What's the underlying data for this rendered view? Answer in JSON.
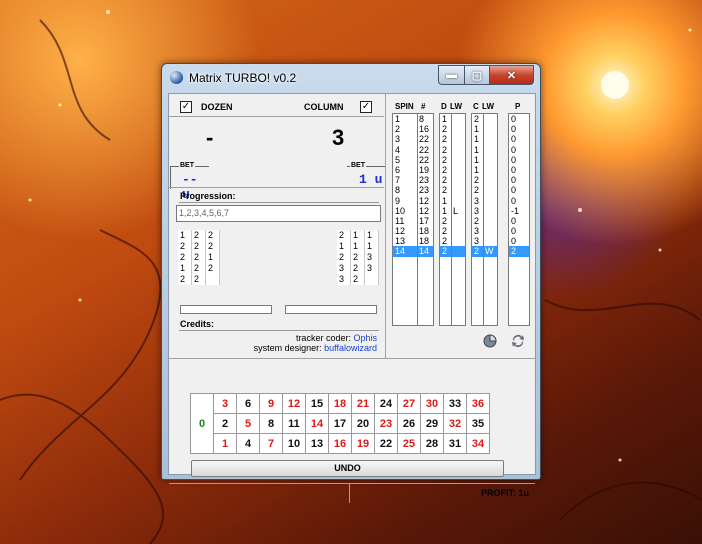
{
  "window": {
    "title": "Matrix TURBO! v0.2",
    "minimize": "▬",
    "maximize": "▢",
    "close": "✕"
  },
  "dozen": {
    "label": "DOZEN",
    "checked": true,
    "value": "-",
    "bet_label": "BET",
    "bet_value": "-- u"
  },
  "column": {
    "label": "COLUMN",
    "checked": true,
    "value": "3",
    "bet_label": "BET",
    "bet_value": "1 u"
  },
  "progression": {
    "label": "Progression:",
    "value": "1,2,3,4,5,6,7"
  },
  "left_grid": [
    [
      "1",
      "2",
      "2"
    ],
    [
      "2",
      "2",
      "2"
    ],
    [
      "2",
      "2",
      "1"
    ],
    [
      "1",
      "2",
      "2"
    ],
    [
      "2",
      "2",
      ""
    ]
  ],
  "right_grid": [
    [
      "2",
      "1",
      "1"
    ],
    [
      "1",
      "1",
      "1"
    ],
    [
      "2",
      "2",
      "3"
    ],
    [
      "3",
      "2",
      "3"
    ],
    [
      "3",
      "2",
      ""
    ]
  ],
  "credits": {
    "label": "Credits:",
    "tracker_label": "tracker coder:",
    "tracker_name": "Ophis",
    "designer_label": "system designer:",
    "designer_name": "buffalowizard"
  },
  "columns_header": {
    "spin": "SPIN",
    "num": "#",
    "d": "D",
    "dlw": "LW",
    "c": "C",
    "clw": "LW",
    "p": "P"
  },
  "spins": [
    "1",
    "2",
    "3",
    "4",
    "5",
    "6",
    "7",
    "8",
    "9",
    "10",
    "11",
    "12",
    "13",
    "14"
  ],
  "numbers": [
    "8",
    "16",
    "22",
    "22",
    "22",
    "19",
    "23",
    "23",
    "12",
    "12",
    "17",
    "18",
    "18",
    "14"
  ],
  "d_vals": [
    "1",
    "2",
    "2",
    "2",
    "2",
    "2",
    "2",
    "2",
    "1",
    "1",
    "2",
    "2",
    "2",
    "2"
  ],
  "d_lw": [
    "",
    "",
    "",
    "",
    "",
    "",
    "",
    "",
    "",
    "L",
    "",
    "",
    "",
    ""
  ],
  "c_vals": [
    "2",
    "1",
    "1",
    "1",
    "1",
    "1",
    "2",
    "2",
    "3",
    "3",
    "2",
    "3",
    "3",
    "2"
  ],
  "c_lw": [
    "",
    "",
    "",
    "",
    "",
    "",
    "",
    "",
    "",
    "",
    "",
    "",
    "",
    "W"
  ],
  "p_vals": [
    "0",
    "0",
    "0",
    "0",
    "0",
    "0",
    "0",
    "0",
    "0",
    "-1",
    "0",
    "0",
    "0",
    "2"
  ],
  "selected_row": 13,
  "board": {
    "zero": "0",
    "rows": [
      [
        {
          "n": "3",
          "c": "red"
        },
        {
          "n": "6",
          "c": "black"
        },
        {
          "n": "9",
          "c": "red"
        },
        {
          "n": "12",
          "c": "red"
        },
        {
          "n": "15",
          "c": "black"
        },
        {
          "n": "18",
          "c": "red"
        },
        {
          "n": "21",
          "c": "red"
        },
        {
          "n": "24",
          "c": "black"
        },
        {
          "n": "27",
          "c": "red"
        },
        {
          "n": "30",
          "c": "red"
        },
        {
          "n": "33",
          "c": "black"
        },
        {
          "n": "36",
          "c": "red"
        }
      ],
      [
        {
          "n": "2",
          "c": "black"
        },
        {
          "n": "5",
          "c": "red"
        },
        {
          "n": "8",
          "c": "black"
        },
        {
          "n": "11",
          "c": "black"
        },
        {
          "n": "14",
          "c": "red"
        },
        {
          "n": "17",
          "c": "black"
        },
        {
          "n": "20",
          "c": "black"
        },
        {
          "n": "23",
          "c": "red"
        },
        {
          "n": "26",
          "c": "black"
        },
        {
          "n": "29",
          "c": "black"
        },
        {
          "n": "32",
          "c": "red"
        },
        {
          "n": "35",
          "c": "black"
        }
      ],
      [
        {
          "n": "1",
          "c": "red"
        },
        {
          "n": "4",
          "c": "black"
        },
        {
          "n": "7",
          "c": "red"
        },
        {
          "n": "10",
          "c": "black"
        },
        {
          "n": "13",
          "c": "black"
        },
        {
          "n": "16",
          "c": "red"
        },
        {
          "n": "19",
          "c": "red"
        },
        {
          "n": "22",
          "c": "black"
        },
        {
          "n": "25",
          "c": "red"
        },
        {
          "n": "28",
          "c": "black"
        },
        {
          "n": "31",
          "c": "black"
        },
        {
          "n": "34",
          "c": "red"
        }
      ]
    ]
  },
  "undo_label": "UNDO",
  "status": {
    "profit": "PROFIT: 1u"
  },
  "icons": {
    "chart": "pie-chart-icon",
    "refresh": "refresh-icon"
  },
  "colors": {
    "red": "#e01818",
    "zero": "#1a8a1a",
    "bet_blue": "#1a2fd0",
    "link_blue": "#1a3fd0",
    "selection": "#3399ff"
  }
}
